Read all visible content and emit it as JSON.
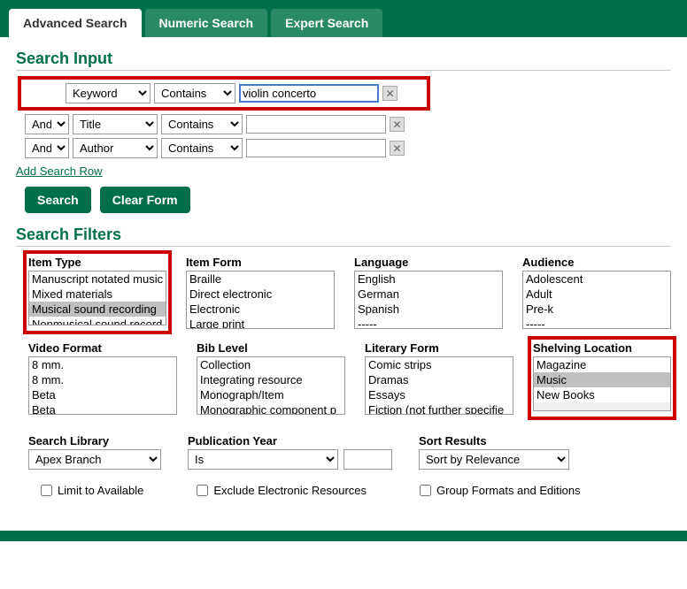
{
  "tabs": {
    "advanced": "Advanced Search",
    "numeric": "Numeric Search",
    "expert": "Expert Search"
  },
  "sections": {
    "input": "Search Input",
    "filters": "Search Filters"
  },
  "rows": [
    {
      "bool": "",
      "field": "Keyword",
      "op": "Contains",
      "term": "violin concerto"
    },
    {
      "bool": "And",
      "field": "Title",
      "op": "Contains",
      "term": ""
    },
    {
      "bool": "And",
      "field": "Author",
      "op": "Contains",
      "term": ""
    }
  ],
  "addRow": "Add Search Row",
  "buttons": {
    "search": "Search",
    "clear": "Clear Form"
  },
  "filters": {
    "itemType": {
      "label": "Item Type",
      "opts": [
        "Manuscript notated music",
        "Mixed materials",
        "Musical sound recording",
        "Nonmusical sound record"
      ],
      "selected": [
        2
      ]
    },
    "itemForm": {
      "label": "Item Form",
      "opts": [
        "Braille",
        "Direct electronic",
        "Electronic",
        "Large print"
      ],
      "selected": []
    },
    "language": {
      "label": "Language",
      "opts": [
        "English",
        "German",
        "Spanish",
        "-----"
      ],
      "selected": []
    },
    "audience": {
      "label": "Audience",
      "opts": [
        "Adolescent",
        "Adult",
        "Pre-k",
        "-----"
      ],
      "selected": []
    },
    "videoFormat": {
      "label": "Video Format",
      "opts": [
        "8 mm.",
        "8 mm.",
        "Beta",
        "Beta"
      ],
      "selected": []
    },
    "bibLevel": {
      "label": "Bib Level",
      "opts": [
        "Collection",
        "Integrating resource",
        "Monograph/Item",
        "Monographic component p"
      ],
      "selected": []
    },
    "literaryForm": {
      "label": "Literary Form",
      "opts": [
        "Comic strips",
        "Dramas",
        "Essays",
        "Fiction (not further specifie"
      ],
      "selected": []
    },
    "shelvingLocation": {
      "label": "Shelving Location",
      "opts": [
        "Magazine",
        "Music",
        "New Books"
      ],
      "selected": [
        1
      ]
    }
  },
  "bottom": {
    "searchLibrary": {
      "label": "Search Library",
      "value": "Apex Branch"
    },
    "pubYear": {
      "label": "Publication Year",
      "op": "Is",
      "value": ""
    },
    "sort": {
      "label": "Sort Results",
      "value": "Sort by Relevance"
    }
  },
  "checks": {
    "limitAvail": "Limit to Available",
    "excludeElec": "Exclude Electronic Resources",
    "groupFormats": "Group Formats and Editions"
  }
}
